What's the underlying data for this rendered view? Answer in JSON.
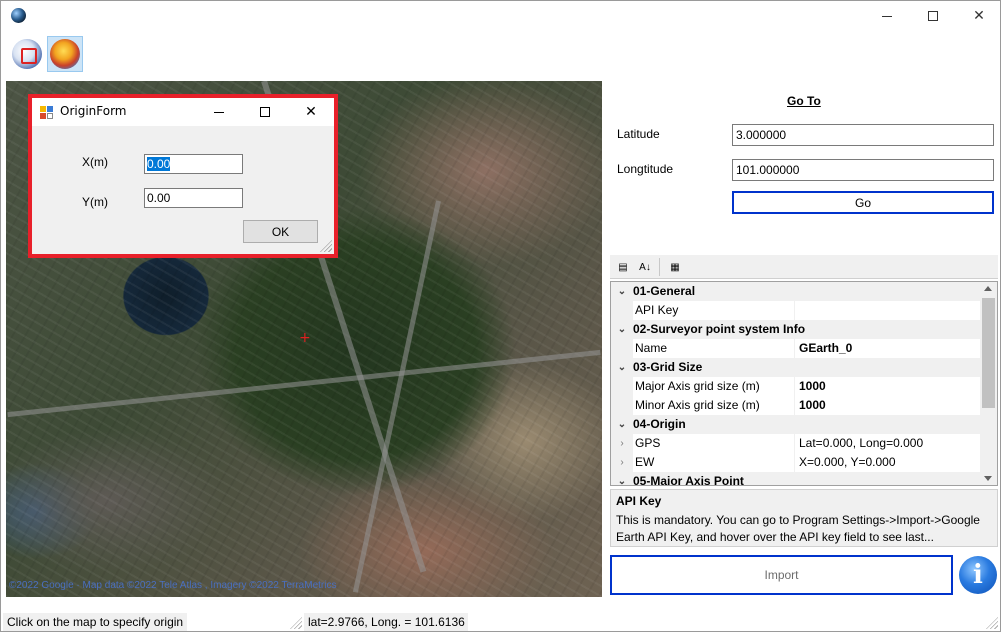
{
  "window": {
    "controls": {
      "minimize": "",
      "maximize": "",
      "close": "✕"
    }
  },
  "toolbar": {
    "buttons": [
      {
        "icon": "set-origin-icon"
      },
      {
        "icon": "earth-overlay-icon"
      }
    ]
  },
  "map": {
    "copyright": "©2022 Google · Map data ©2022 Tele Atlas , Imagery ©2022 TerraMetrics",
    "crosshair": "+"
  },
  "origin_form": {
    "title": "OriginForm",
    "x_label": "X(m)",
    "x_value": "0.00",
    "y_label": "Y(m)",
    "y_value": "0.00",
    "ok_label": "OK",
    "close": "✕"
  },
  "goto": {
    "title": "Go To",
    "latitude_label": "Latitude",
    "latitude_value": "3.000000",
    "longitude_label": "Longtitude",
    "longitude_value": "101.000000",
    "go_label": "Go"
  },
  "property_grid": {
    "toolbar": {
      "categorized_icon": "▤",
      "alphabetical_icon": "A↓",
      "pages_icon": "▦"
    },
    "rows": [
      {
        "kind": "category",
        "chevron": "⌄",
        "name": "01-General"
      },
      {
        "kind": "property",
        "expander": "",
        "name": "API Key",
        "value": "",
        "bold": false
      },
      {
        "kind": "category",
        "chevron": "⌄",
        "name": "02-Surveyor point system Info"
      },
      {
        "kind": "property",
        "expander": "",
        "name": "Name",
        "value": "GEarth_0",
        "bold": true
      },
      {
        "kind": "category",
        "chevron": "⌄",
        "name": "03-Grid Size"
      },
      {
        "kind": "property",
        "expander": "",
        "name": "Major Axis grid size (m)",
        "value": "1000",
        "bold": true
      },
      {
        "kind": "property",
        "expander": "",
        "name": "Minor Axis grid size (m)",
        "value": "1000",
        "bold": true
      },
      {
        "kind": "category",
        "chevron": "⌄",
        "name": "04-Origin"
      },
      {
        "kind": "property",
        "expander": "›",
        "name": "GPS",
        "value": "Lat=0.000, Long=0.000",
        "bold": false
      },
      {
        "kind": "property",
        "expander": "›",
        "name": "EW",
        "value": "X=0.000, Y=0.000",
        "bold": false
      },
      {
        "kind": "category",
        "chevron": "⌄",
        "name": "05-Major Axis Point"
      }
    ],
    "help_title": "API Key",
    "help_description": "This is mandatory. You can go to Program Settings->Import->Google Earth API Key, and hover over the API key field to see last..."
  },
  "import_label": "Import",
  "info_label": "i",
  "status": {
    "hint": "Click on the map to specify origin",
    "coords": "lat=2.9766, Long. = 101.6136"
  }
}
